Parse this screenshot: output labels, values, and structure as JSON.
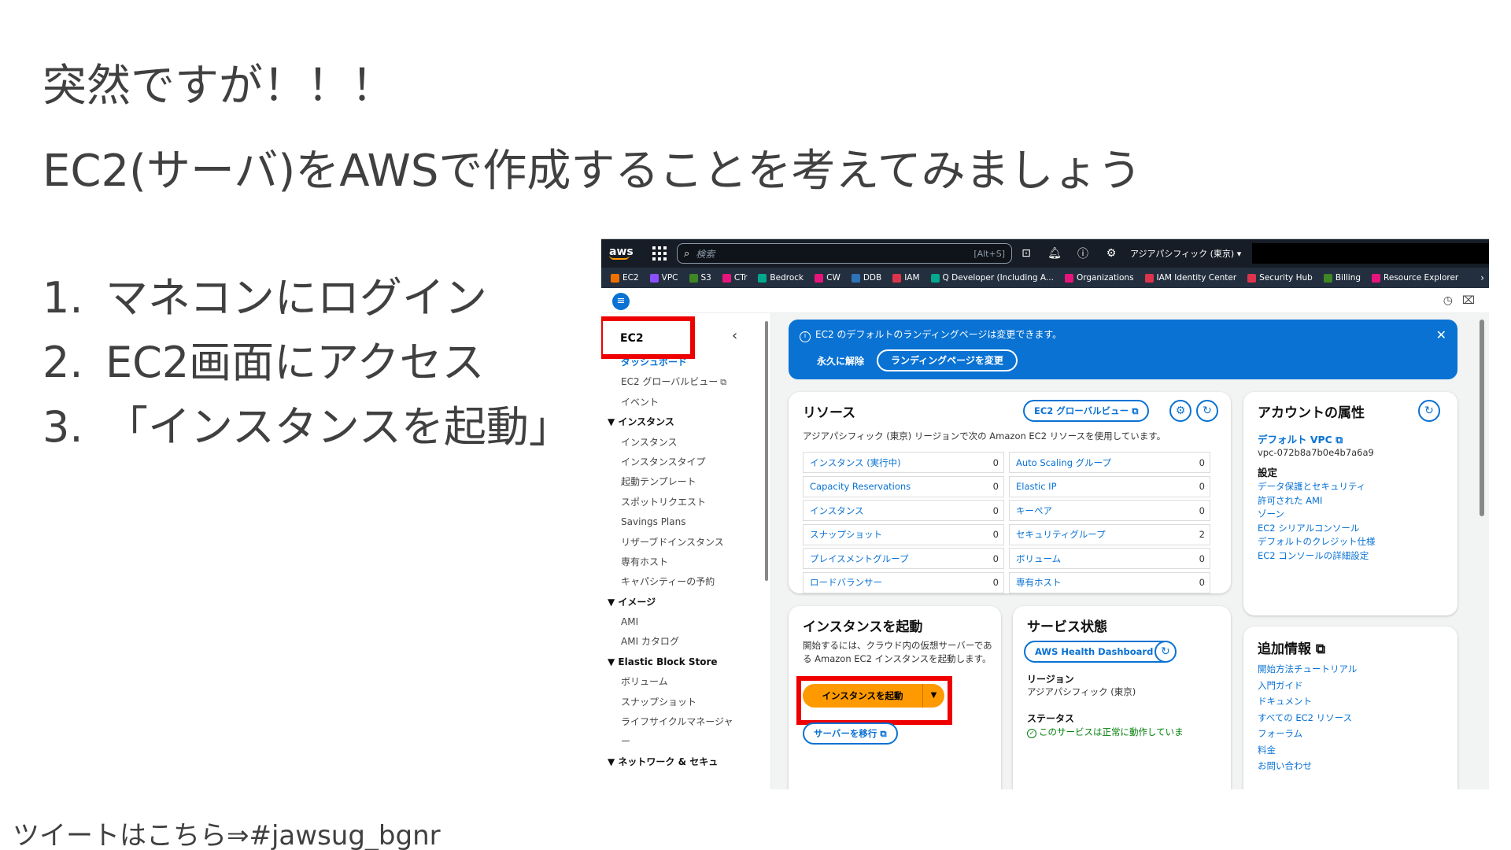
{
  "slide": {
    "heading": "突然ですが！！！",
    "subheading": "EC2(サーバ)をAWSで作成することを考えてみましょう",
    "steps": [
      {
        "num": "1.",
        "text": "マネコンにログイン"
      },
      {
        "num": "2.",
        "text": "EC2画面にアクセス"
      },
      {
        "num": "3.",
        "text": "「インスタンスを起動」"
      }
    ],
    "footer": "ツイートはこちら⇒#jawsug_bgnr"
  },
  "console": {
    "topbar": {
      "logo": "aws",
      "search_placeholder": "検索",
      "search_shortcut": "[Alt+S]",
      "region": "アジアパシフィック (東京) ▾"
    },
    "bookmarks": [
      {
        "label": "EC2",
        "color": "#ed7100"
      },
      {
        "label": "VPC",
        "color": "#8c4fff"
      },
      {
        "label": "S3",
        "color": "#3f8624"
      },
      {
        "label": "CTr",
        "color": "#e7157b"
      },
      {
        "label": "Bedrock",
        "color": "#01a88d"
      },
      {
        "label": "CW",
        "color": "#e7157b"
      },
      {
        "label": "DDB",
        "color": "#2e73b8"
      },
      {
        "label": "IAM",
        "color": "#dd344c"
      },
      {
        "label": "Q Developer (Including A...",
        "color": "#01a88d"
      },
      {
        "label": "Organizations",
        "color": "#e7157b"
      },
      {
        "label": "IAM Identity Center",
        "color": "#dd344c"
      },
      {
        "label": "Security Hub",
        "color": "#dd344c"
      },
      {
        "label": "Billing",
        "color": "#3f8624"
      },
      {
        "label": "Resource Explorer",
        "color": "#e7157b"
      }
    ],
    "sidebar": {
      "title": "EC2",
      "items": [
        {
          "label": "ダッシュボード",
          "kind": "active"
        },
        {
          "label": "EC2 グローバルビュー",
          "kind": "item",
          "ext": "⧉"
        },
        {
          "label": "イベント",
          "kind": "item"
        },
        {
          "label": "▼ インスタンス",
          "kind": "section"
        },
        {
          "label": "インスタンス",
          "kind": "item"
        },
        {
          "label": "インスタンスタイプ",
          "kind": "item"
        },
        {
          "label": "起動テンプレート",
          "kind": "item"
        },
        {
          "label": "スポットリクエスト",
          "kind": "item"
        },
        {
          "label": "Savings Plans",
          "kind": "item"
        },
        {
          "label": "リザーブドインスタンス",
          "kind": "item"
        },
        {
          "label": "専有ホスト",
          "kind": "item"
        },
        {
          "label": "キャパシティーの予約",
          "kind": "item"
        },
        {
          "label": "▼ イメージ",
          "kind": "section"
        },
        {
          "label": "AMI",
          "kind": "item"
        },
        {
          "label": "AMI カタログ",
          "kind": "item"
        },
        {
          "label": "▼ Elastic Block Store",
          "kind": "section"
        },
        {
          "label": "ボリューム",
          "kind": "item"
        },
        {
          "label": "スナップショット",
          "kind": "item"
        },
        {
          "label": "ライフサイクルマネージャ",
          "kind": "item"
        },
        {
          "label": "ー",
          "kind": "item"
        },
        {
          "label": "▼ ネットワーク & セキュ",
          "kind": "section"
        }
      ]
    },
    "flash": {
      "message": "EC2 のデフォルトのランディングページは変更できます。",
      "dismiss": "永久に解除",
      "button": "ランディングページを変更"
    },
    "resources": {
      "title": "リソース",
      "global_view_button": "EC2 グローバルビュー ⧉",
      "description": "アジアパシフィック (東京) リージョンで次の Amazon EC2 リソースを使用しています。",
      "rows": [
        [
          {
            "label": "インスタンス (実行中)",
            "value": "0"
          },
          {
            "label": "Auto Scaling グループ",
            "value": "0"
          }
        ],
        [
          {
            "label": "Capacity Reservations",
            "value": "0"
          },
          {
            "label": "Elastic IP",
            "value": "0"
          }
        ],
        [
          {
            "label": "インスタンス",
            "value": "0"
          },
          {
            "label": "キーペア",
            "value": "0"
          }
        ],
        [
          {
            "label": "スナップショット",
            "value": "0"
          },
          {
            "label": "セキュリティグループ",
            "value": "2"
          }
        ],
        [
          {
            "label": "プレイスメントグループ",
            "value": "0"
          },
          {
            "label": "ボリューム",
            "value": "0"
          }
        ],
        [
          {
            "label": "ロードバランサー",
            "value": "0"
          },
          {
            "label": "専有ホスト",
            "value": "0"
          }
        ]
      ]
    },
    "launch": {
      "title": "インスタンスを起動",
      "description": "開始するには、クラウド内の仮想サーバーである Amazon EC2 インスタンスを起動します。",
      "button": "インスタンスを起動",
      "split": "▼",
      "migrate_button": "サーバーを移行 ⧉"
    },
    "service_health": {
      "title": "サービス状態",
      "dashboard_button": "AWS Health Dashboard ⧉",
      "region_label": "リージョン",
      "region_value": "アジアパシフィック (東京)",
      "status_label": "ステータス",
      "status_value": "このサービスは正常に動作していま"
    },
    "account": {
      "title": "アカウントの属性",
      "vpc_link": "デフォルト VPC ⧉",
      "vpc_id": "vpc-072b8a7b0e4b7a6a9",
      "settings_label": "設定",
      "links": [
        "データ保護とセキュリティ",
        "許可された AMI",
        "ゾーン",
        "EC2 シリアルコンソール",
        "デフォルトのクレジット仕様",
        "EC2 コンソールの詳細設定"
      ]
    },
    "additional_info": {
      "title": "追加情報 ⧉",
      "links": [
        "開始方法チュートリアル",
        "入門ガイド",
        "ドキュメント",
        "すべての EC2 リソース",
        "フォーラム",
        "料金",
        "お問い合わせ"
      ]
    }
  }
}
